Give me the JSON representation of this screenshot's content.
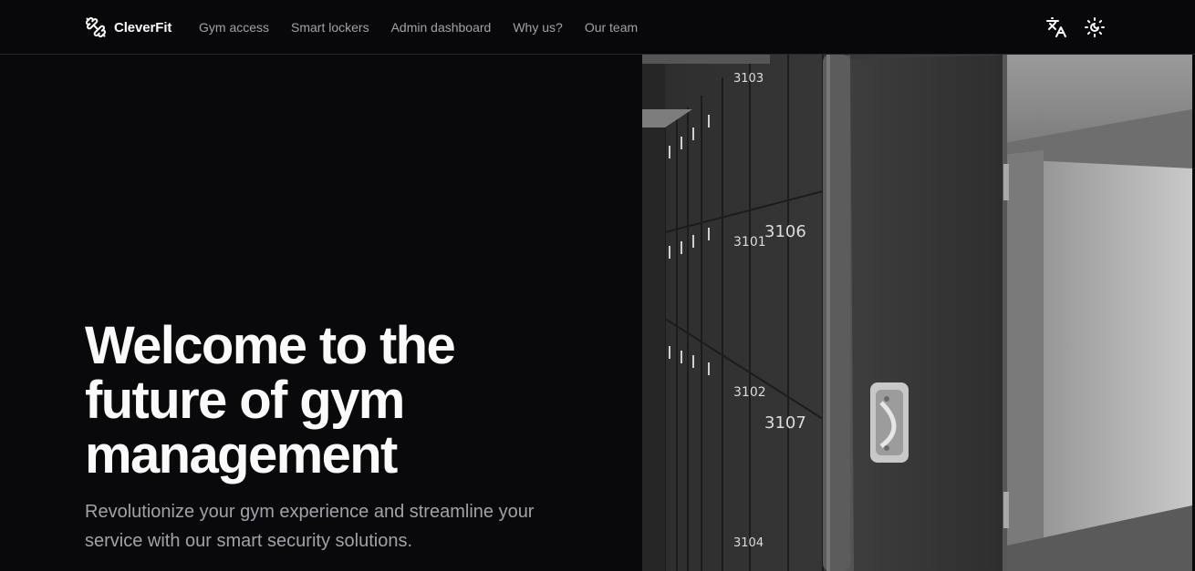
{
  "brand": {
    "name": "CleverFit",
    "icon": "dumbbell-icon"
  },
  "nav": {
    "links": [
      {
        "label": "Gym access"
      },
      {
        "label": "Smart lockers"
      },
      {
        "label": "Admin dashboard"
      },
      {
        "label": "Why us?"
      },
      {
        "label": "Our team"
      }
    ],
    "actions": [
      {
        "icon": "translate-icon"
      },
      {
        "icon": "theme-toggle-icon"
      }
    ]
  },
  "hero": {
    "title": "Welcome to the future of gym management",
    "subtitle": "Revolutionize your gym experience and streamline your service with our smart security solutions.",
    "image": {
      "icon": "locker-photo",
      "locker_numbers": [
        "3106",
        "3101",
        "3107",
        "3102",
        "3103",
        "3104"
      ]
    }
  },
  "colors": {
    "background": "#09090b",
    "text": "#fafafa",
    "muted": "#a1a1aa",
    "border": "#27272a"
  }
}
